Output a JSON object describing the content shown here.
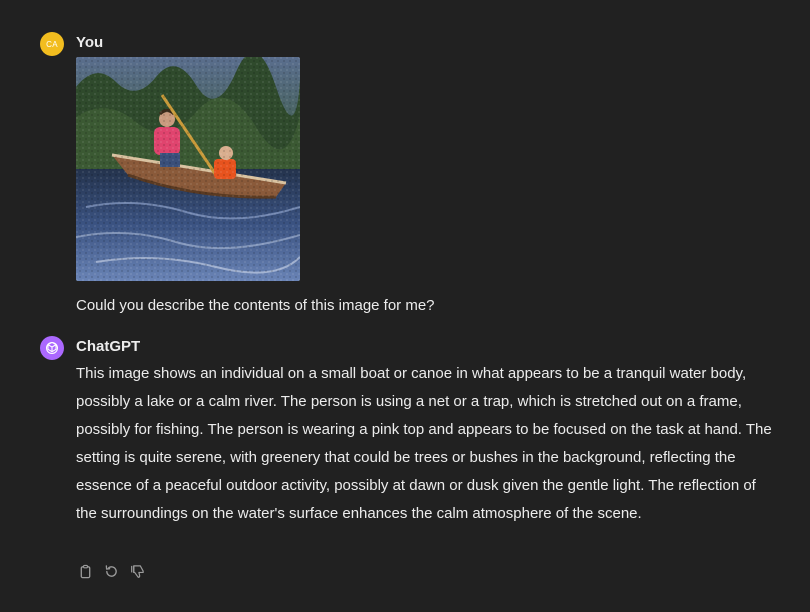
{
  "conversation": {
    "user_message": {
      "avatar_initials": "CA",
      "author": "You",
      "text": "Could you describe the contents of this image for me?"
    },
    "assistant_message": {
      "author": "ChatGPT",
      "text": "This image shows an individual on a small boat or canoe in what appears to be a tranquil water body, possibly a lake or a calm river. The person is using a net or a trap, which is stretched out on a frame, possibly for fishing. The person is wearing a pink top and appears to be focused on the task at hand. The setting is quite serene, with greenery that could be trees or bushes in the background, reflecting the essence of a peaceful outdoor activity, possibly at dawn or dusk given the gentle light. The reflection of the surroundings on the water's surface enhances the calm atmosphere of the scene.",
      "actions": [
        "copy-icon",
        "regenerate-icon",
        "thumbs-down-icon"
      ]
    }
  },
  "colors": {
    "background": "#212121",
    "text": "#ececec",
    "user_avatar": "#f2bd1f",
    "assistant_avatar": "#ab68ff",
    "icon": "#9b9b9b"
  }
}
